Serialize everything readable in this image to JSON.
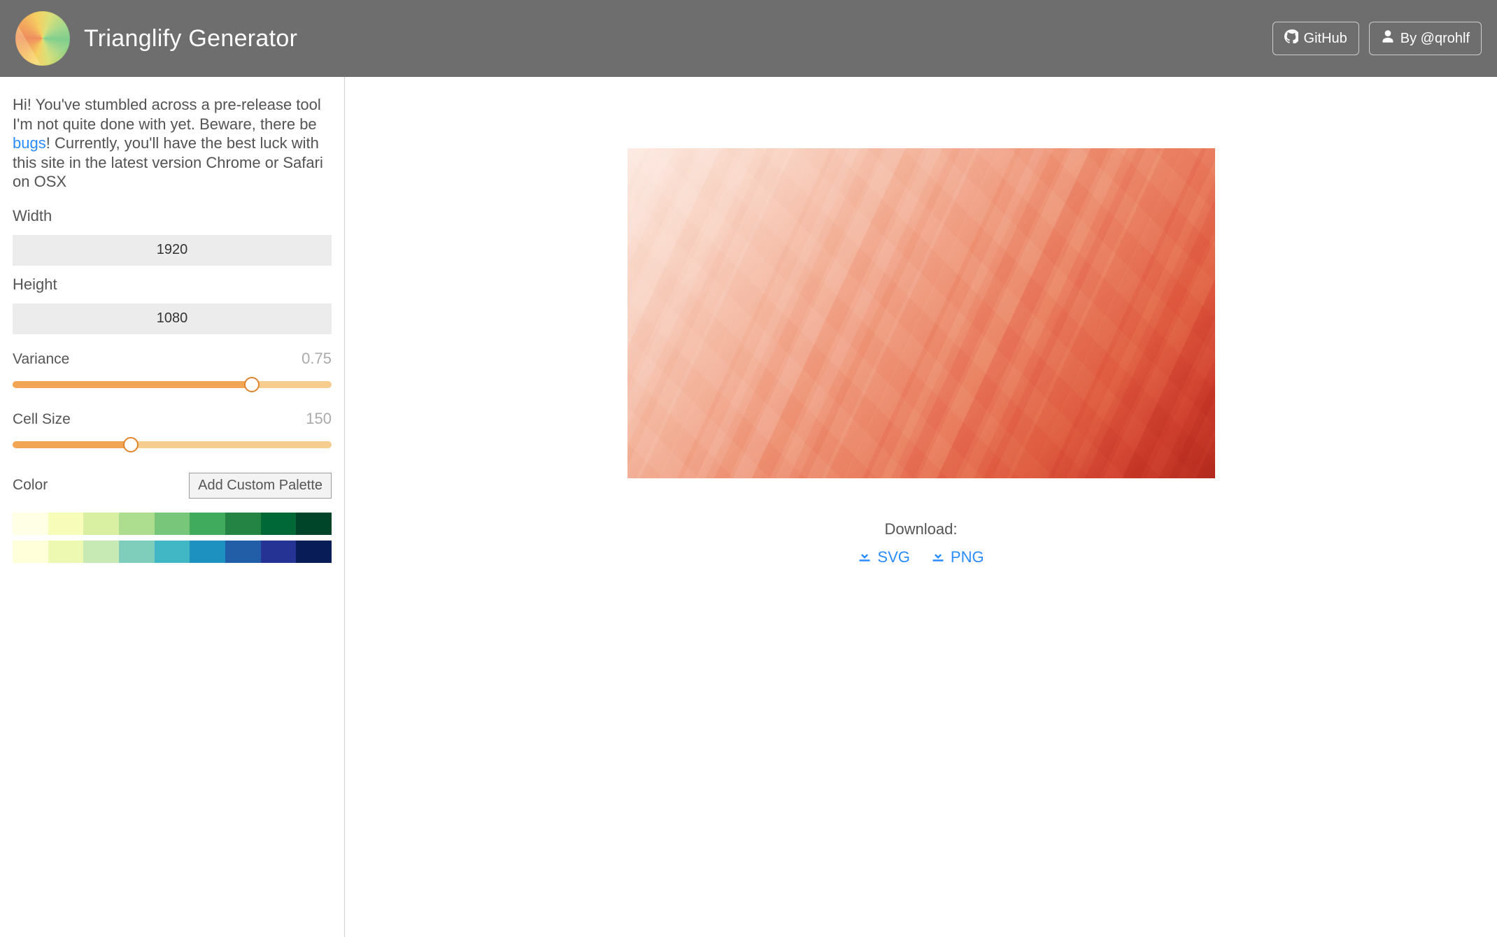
{
  "header": {
    "title": "Trianglify Generator",
    "github_label": "GitHub",
    "author_label": "By @qrohlf"
  },
  "sidebar": {
    "intro_prefix": "Hi! You've stumbled across a pre-release tool I'm not quite done with yet. Beware, there be ",
    "intro_link": "bugs",
    "intro_suffix": "! Currently, you'll have the best luck with this site in the latest version Chrome or Safari on OSX",
    "width_label": "Width",
    "width_value": "1920",
    "height_label": "Height",
    "height_value": "1080",
    "variance_label": "Variance",
    "variance_value": "0.75",
    "variance_pct": 75,
    "cellsize_label": "Cell Size",
    "cellsize_value": "150",
    "cellsize_pct": 37,
    "color_label": "Color",
    "add_palette_label": "Add Custom Palette",
    "palettes": [
      [
        "#ffffe5",
        "#f7fcb9",
        "#d9f0a3",
        "#addd8e",
        "#78c679",
        "#41ab5d",
        "#238443",
        "#006837",
        "#004529"
      ],
      [
        "#ffffd9",
        "#edf8b1",
        "#c7e9b4",
        "#7fcdbb",
        "#41b6c4",
        "#1d91c0",
        "#225ea8",
        "#253494",
        "#081d58"
      ]
    ]
  },
  "preview": {
    "download_label": "Download:",
    "svg_label": "SVG",
    "png_label": "PNG"
  }
}
